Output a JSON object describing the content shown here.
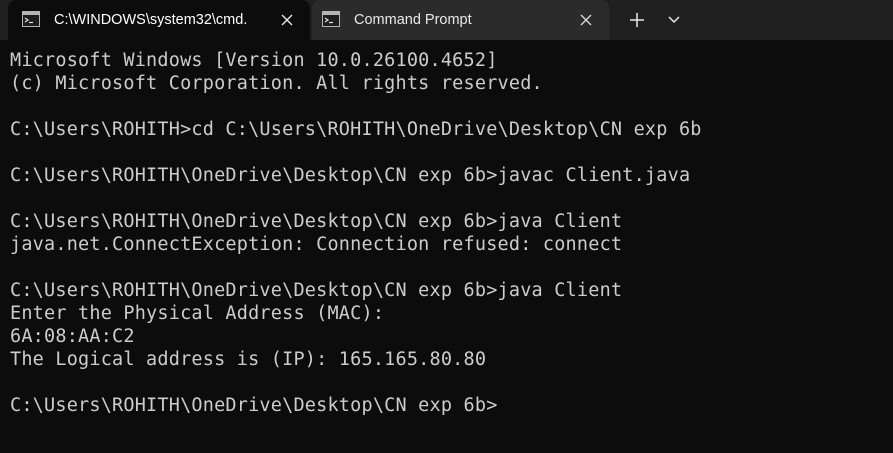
{
  "tabs": [
    {
      "title": "C:\\WINDOWS\\system32\\cmd.",
      "icon": "terminal-icon",
      "active": true
    },
    {
      "title": "Command Prompt",
      "icon": "terminal-icon",
      "active": false
    }
  ],
  "tabbar": {
    "new_tab_icon": "plus-icon",
    "dropdown_icon": "chevron-down-icon"
  },
  "colors": {
    "background": "#0c0c0c",
    "tabbar": "#202020",
    "text": "#cccccc"
  },
  "terminal": {
    "lines": [
      "Microsoft Windows [Version 10.0.26100.4652]",
      "(c) Microsoft Corporation. All rights reserved.",
      "",
      "C:\\Users\\ROHITH>cd C:\\Users\\ROHITH\\OneDrive\\Desktop\\CN exp 6b",
      "",
      "C:\\Users\\ROHITH\\OneDrive\\Desktop\\CN exp 6b>javac Client.java",
      "",
      "C:\\Users\\ROHITH\\OneDrive\\Desktop\\CN exp 6b>java Client",
      "java.net.ConnectException: Connection refused: connect",
      "",
      "C:\\Users\\ROHITH\\OneDrive\\Desktop\\CN exp 6b>java Client",
      "Enter the Physical Address (MAC):",
      "6A:08:AA:C2",
      "The Logical address is (IP): 165.165.80.80",
      "",
      "C:\\Users\\ROHITH\\OneDrive\\Desktop\\CN exp 6b>"
    ]
  }
}
